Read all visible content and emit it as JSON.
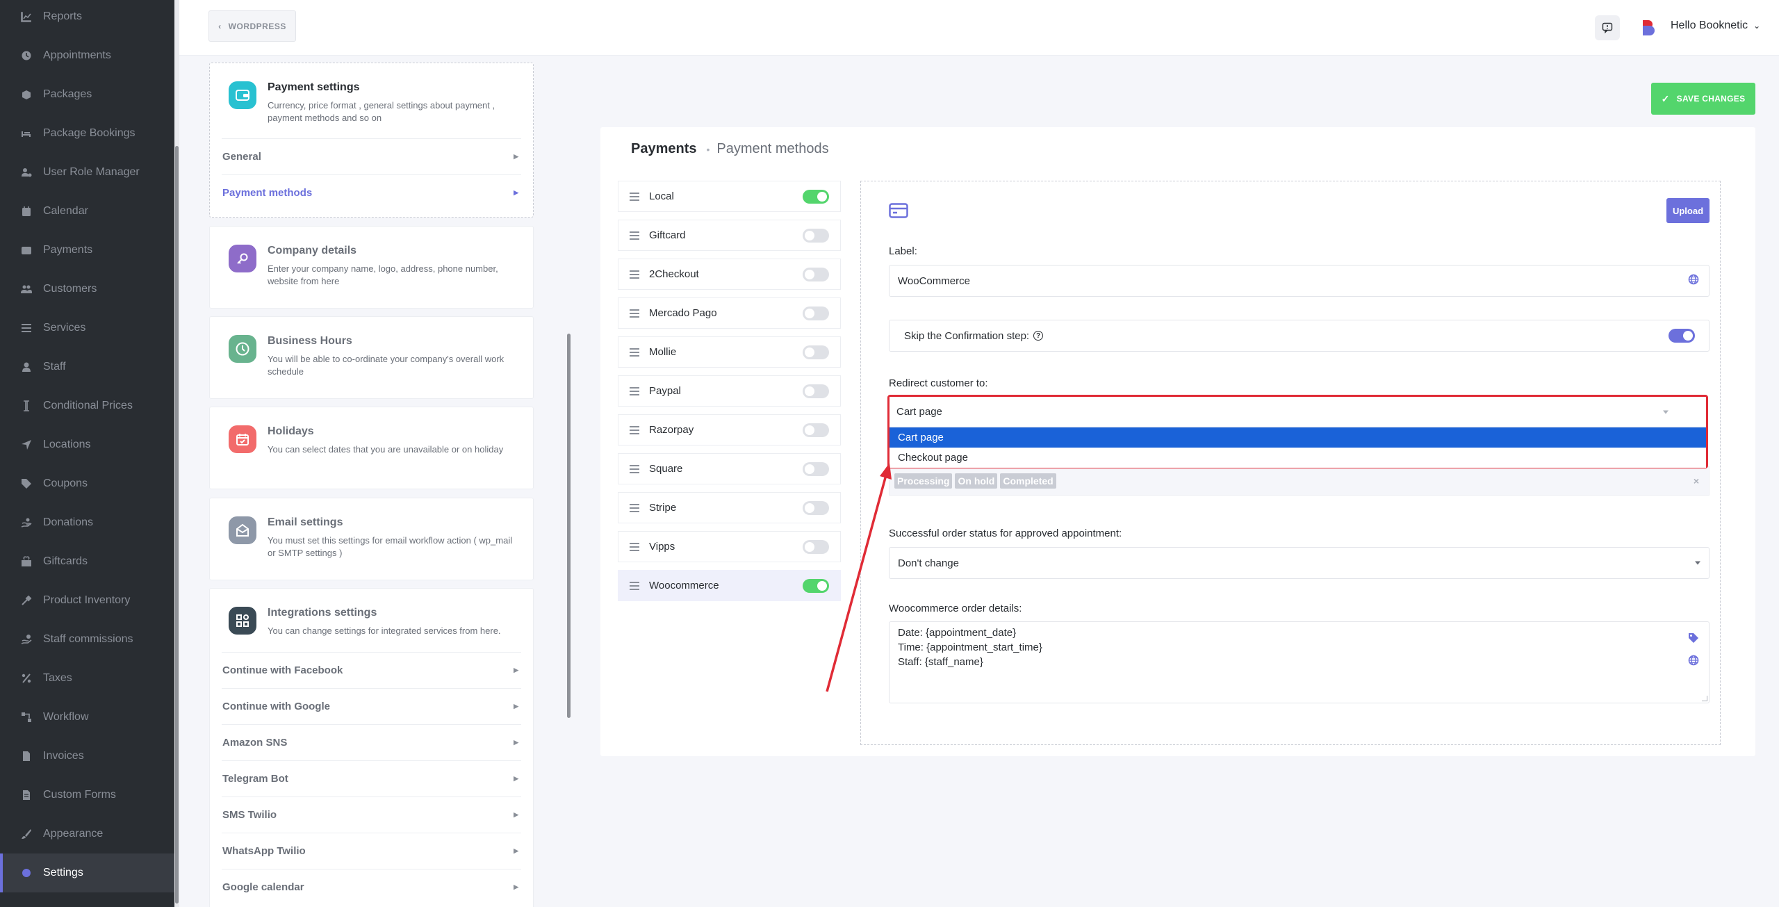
{
  "sidebar": {
    "items": [
      {
        "label": "Reports",
        "icon": "chart-icon"
      },
      {
        "label": "Appointments",
        "icon": "clock-icon"
      },
      {
        "label": "Packages",
        "icon": "package-icon"
      },
      {
        "label": "Package Bookings",
        "icon": "bed-icon"
      },
      {
        "label": "User Role Manager",
        "icon": "user-cog-icon"
      },
      {
        "label": "Calendar",
        "icon": "calendar-icon"
      },
      {
        "label": "Payments",
        "icon": "wallet-icon"
      },
      {
        "label": "Customers",
        "icon": "users-icon"
      },
      {
        "label": "Services",
        "icon": "list-icon"
      },
      {
        "label": "Staff",
        "icon": "user-icon"
      },
      {
        "label": "Conditional Prices",
        "icon": "cursor-icon"
      },
      {
        "label": "Locations",
        "icon": "location-arrow-icon"
      },
      {
        "label": "Coupons",
        "icon": "tag-icon"
      },
      {
        "label": "Donations",
        "icon": "hand-icon"
      },
      {
        "label": "Giftcards",
        "icon": "gift-icon"
      },
      {
        "label": "Product Inventory",
        "icon": "tools-icon"
      },
      {
        "label": "Staff commissions",
        "icon": "hand-coin-icon"
      },
      {
        "label": "Taxes",
        "icon": "percent-icon"
      },
      {
        "label": "Workflow",
        "icon": "workflow-icon"
      },
      {
        "label": "Invoices",
        "icon": "invoice-icon"
      },
      {
        "label": "Custom Forms",
        "icon": "form-icon"
      },
      {
        "label": "Appearance",
        "icon": "brush-icon"
      },
      {
        "label": "Settings",
        "icon": "gear-icon",
        "active": true
      }
    ]
  },
  "header": {
    "back_label": "WORDPRESS",
    "user_greeting": "Hello Booknetic"
  },
  "settings_nav": {
    "payment": {
      "title": "Payment settings",
      "desc": "Currency, price format , general settings about payment , payment methods and so on",
      "subitems": [
        "General",
        "Payment methods"
      ]
    },
    "company": {
      "title": "Company details",
      "desc": "Enter your company name, logo, address, phone number, website from here"
    },
    "hours": {
      "title": "Business Hours",
      "desc": "You will be able to co-ordinate your company's overall work schedule"
    },
    "holidays": {
      "title": "Holidays",
      "desc": "You can select dates that you are unavailable or on holiday"
    },
    "email": {
      "title": "Email settings",
      "desc": "You must set this settings for email workflow action ( wp_mail or SMTP settings )"
    },
    "integrations": {
      "title": "Integrations settings",
      "desc": "You can change settings for integrated services from here.",
      "subitems": [
        "Continue with Facebook",
        "Continue with Google",
        "Amazon SNS",
        "Telegram Bot",
        "SMS Twilio",
        "WhatsApp Twilio",
        "Google calendar"
      ]
    }
  },
  "main": {
    "save_label": "SAVE CHANGES",
    "breadcrumb": {
      "root": "Payments",
      "current": "Payment methods"
    },
    "gateways": [
      {
        "name": "Local",
        "enabled": true
      },
      {
        "name": "Giftcard",
        "enabled": false
      },
      {
        "name": "2Checkout",
        "enabled": false
      },
      {
        "name": "Mercado Pago",
        "enabled": false
      },
      {
        "name": "Mollie",
        "enabled": false
      },
      {
        "name": "Paypal",
        "enabled": false
      },
      {
        "name": "Razorpay",
        "enabled": false
      },
      {
        "name": "Square",
        "enabled": false
      },
      {
        "name": "Stripe",
        "enabled": false
      },
      {
        "name": "Vipps",
        "enabled": false
      },
      {
        "name": "Woocommerce",
        "enabled": true,
        "selected": true
      }
    ],
    "form": {
      "upload_label": "Upload",
      "label_label": "Label:",
      "label_value": "WooCommerce",
      "skip_confirmation_label": "Skip the Confirmation step:",
      "skip_confirmation_enabled": true,
      "redirect_label": "Redirect customer to:",
      "redirect_value": "Cart page",
      "redirect_options": [
        "Cart page",
        "Checkout page"
      ],
      "status_tags": [
        "Processing",
        "On hold",
        "Completed"
      ],
      "approved_status_label": "Successful order status for approved appointment:",
      "approved_status_value": "Don't change",
      "order_details_label": "Woocommerce order details:",
      "order_details_lines": [
        "Date: {appointment_date}",
        "Time: {appointment_start_time}",
        "Staff: {staff_name}"
      ]
    }
  },
  "colors": {
    "sidebar_bg": "#292d32",
    "accent": "#6c70dc",
    "success": "#53d56c",
    "highlight_red": "#e02b36",
    "option_highlight": "#1a62d8"
  }
}
